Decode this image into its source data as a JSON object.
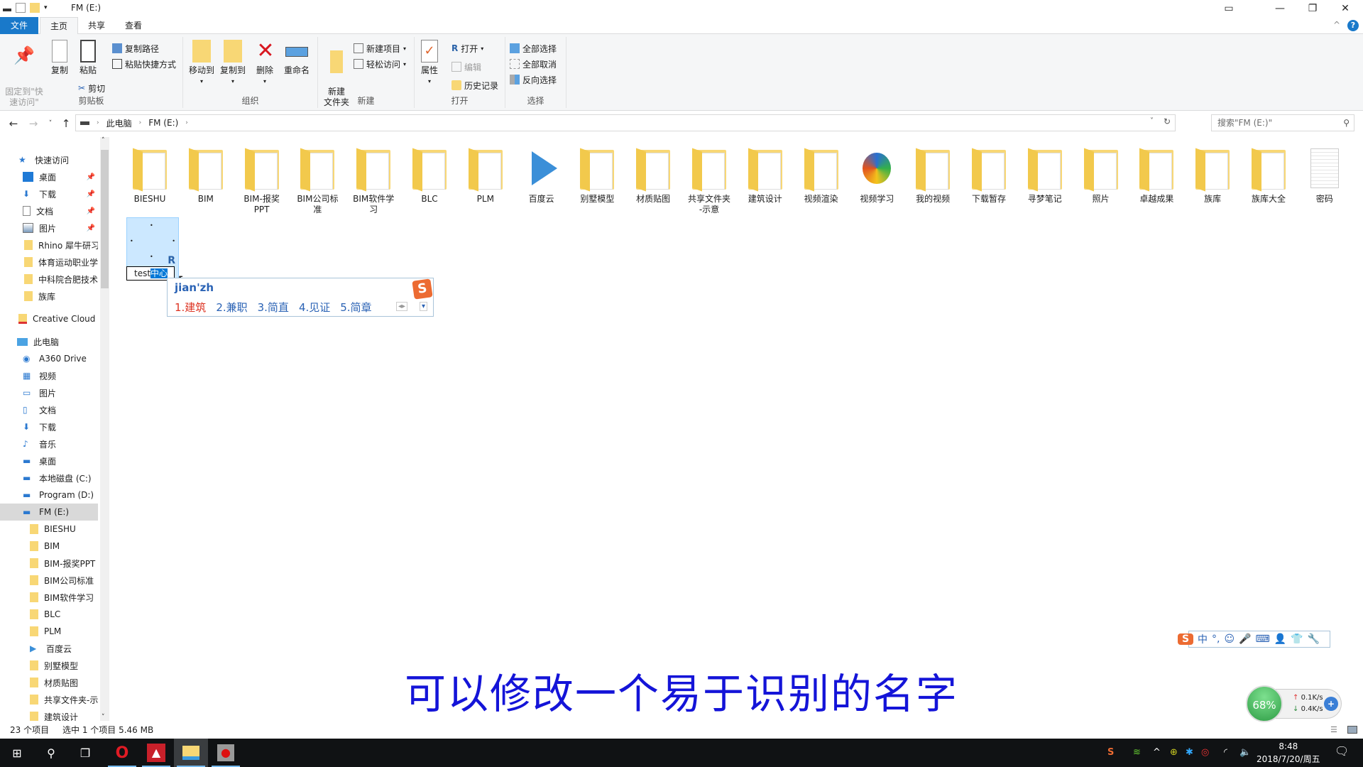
{
  "window": {
    "title": "FM (E:)",
    "controls": {
      "tablet": "▭",
      "minimize": "—",
      "restore": "❐",
      "close": "✕"
    }
  },
  "menu_tabs": [
    "文件",
    "主页",
    "共享",
    "查看"
  ],
  "ribbon": {
    "clipboard": {
      "label": "剪贴板",
      "pin": "固定到\"快\n速访问\"",
      "copy": "复制",
      "paste": "粘贴",
      "copy_path": "复制路径",
      "paste_shortcut": "粘贴快捷方式",
      "cut": "剪切"
    },
    "organize": {
      "label": "组织",
      "move_to": "移动到",
      "copy_to": "复制到",
      "delete": "删除",
      "rename": "重命名"
    },
    "new": {
      "label": "新建",
      "new_folder": "新建\n文件夹",
      "new_item": "新建项目",
      "easy_access": "轻松访问"
    },
    "open": {
      "label": "打开",
      "properties": "属性",
      "open": "打开",
      "edit": "编辑",
      "history": "历史记录"
    },
    "select": {
      "label": "选择",
      "select_all": "全部选择",
      "select_none": "全部取消",
      "invert": "反向选择"
    }
  },
  "address": {
    "breadcrumb": [
      "此电脑",
      "FM (E:)"
    ],
    "search_placeholder": "搜索\"FM (E:)\""
  },
  "nav_pane": {
    "quick_access": "快速访问",
    "quick_items": [
      {
        "label": "桌面",
        "pinned": true
      },
      {
        "label": "下载",
        "pinned": true
      },
      {
        "label": "文档",
        "pinned": true
      },
      {
        "label": "图片",
        "pinned": true
      },
      {
        "label": "Rhino 犀牛研习"
      },
      {
        "label": "体育运动职业学"
      },
      {
        "label": "中科院合肥技术"
      },
      {
        "label": "族库"
      }
    ],
    "creative_cloud": "Creative Cloud F",
    "this_pc": "此电脑",
    "pc_items": [
      "A360 Drive",
      "视频",
      "图片",
      "文档",
      "下载",
      "音乐",
      "桌面",
      "本地磁盘 (C:)",
      "Program (D:)",
      "FM (E:)"
    ],
    "fm_children": [
      "BIESHU",
      "BIM",
      "BIM-报奖PPT",
      "BIM公司标准",
      "BIM软件学习",
      "BLC",
      "PLM",
      "百度云",
      "别墅模型",
      "材质贴图",
      "共享文件夹-示",
      "建筑设计"
    ]
  },
  "files": [
    "BIESHU",
    "BIM",
    "BIM-报奖\nPPT",
    "BIM公司标\n准",
    "BIM软件学\n习",
    "BLC",
    "PLM",
    "百度云",
    "别墅模型",
    "材质贴图",
    "共享文件夹\n-示意",
    "建筑设计",
    "视频渲染",
    "视频学习",
    "我的视频",
    "下载暂存",
    "寻梦笔记",
    "照片",
    "卓越成果",
    "族库",
    "族库大全",
    "密码"
  ],
  "rename": {
    "prefix": "test",
    "selected": "中心"
  },
  "ime": {
    "pinyin": "jian'zh",
    "candidates": [
      "1.建筑",
      "2.兼职",
      "3.简直",
      "4.见证",
      "5.简章"
    ],
    "toolbar": [
      "中",
      "°,",
      "☺",
      "🎤",
      "⌨",
      "👤",
      "👕",
      "🔧"
    ]
  },
  "status": {
    "count": "23 个项目",
    "selection": "选中 1 个项目  5.46 MB"
  },
  "caption": "可以修改一个易于识别的名字",
  "net_widget": {
    "percent": "68%",
    "up": "0.1K/s",
    "down": "0.4K/s"
  },
  "taskbar": {
    "time": "8:48",
    "date": "2018/7/20/周五"
  }
}
